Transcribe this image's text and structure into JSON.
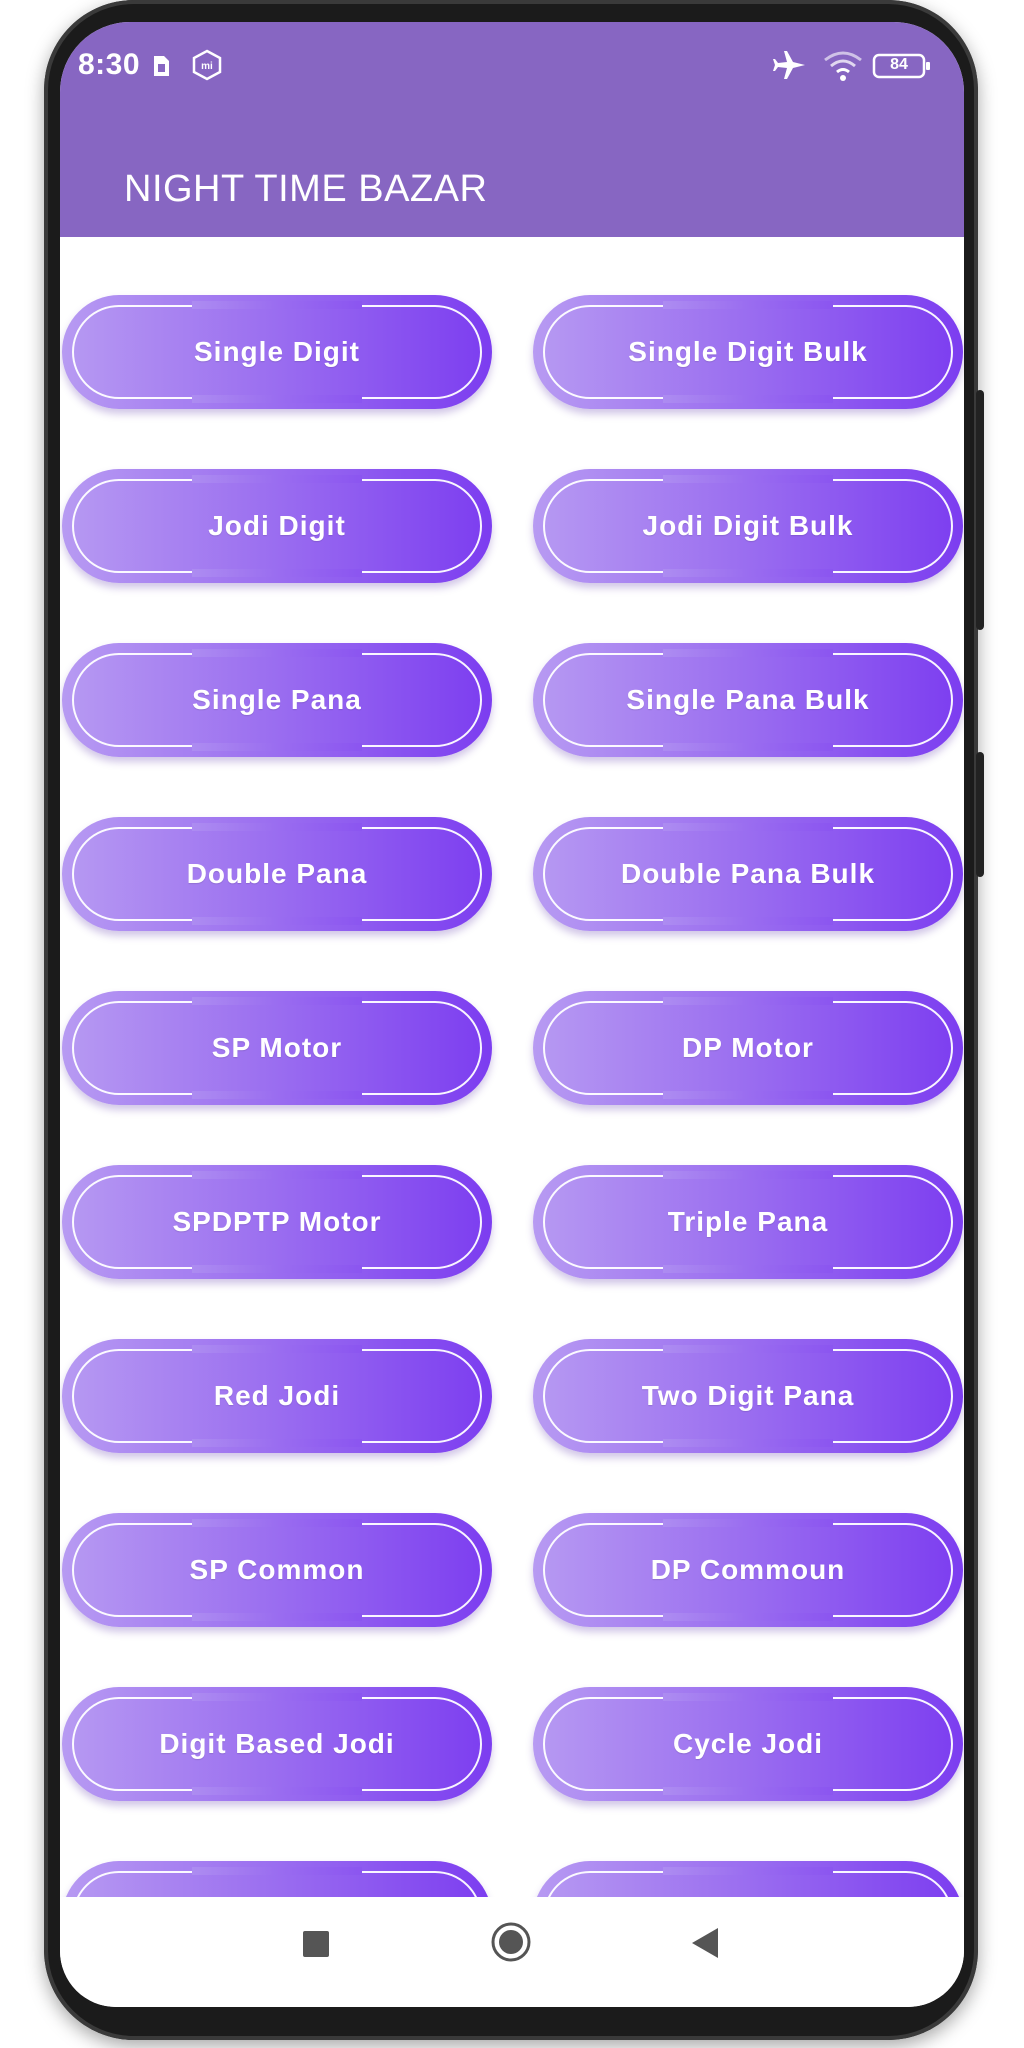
{
  "status_bar": {
    "time": "8:30",
    "battery": "84",
    "icons": [
      "sim-card-icon",
      "mi-shield-icon",
      "airplane-icon",
      "wifi-icon",
      "battery-icon"
    ]
  },
  "app_bar": {
    "title": "NIGHT TIME BAZAR",
    "color": "#8766c2"
  },
  "menu": {
    "gradient": [
      "#b79af2",
      "#7c3df0"
    ],
    "items": [
      {
        "label": "Single Digit"
      },
      {
        "label": "Single Digit Bulk"
      },
      {
        "label": "Jodi Digit"
      },
      {
        "label": "Jodi Digit Bulk"
      },
      {
        "label": "Single Pana"
      },
      {
        "label": "Single Pana Bulk"
      },
      {
        "label": "Double Pana"
      },
      {
        "label": "Double Pana Bulk"
      },
      {
        "label": "SP Motor"
      },
      {
        "label": "DP Motor"
      },
      {
        "label": "SPDPTP Motor"
      },
      {
        "label": "Triple Pana"
      },
      {
        "label": "Red Jodi"
      },
      {
        "label": "Two Digit Pana"
      },
      {
        "label": "SP Common"
      },
      {
        "label": "DP Commoun"
      },
      {
        "label": "Digit Based Jodi"
      },
      {
        "label": "Cycle Jodi"
      },
      {
        "label": ""
      },
      {
        "label": ""
      }
    ]
  },
  "nav_bar": {
    "icons": [
      "recents-icon",
      "home-icon",
      "back-icon"
    ]
  }
}
